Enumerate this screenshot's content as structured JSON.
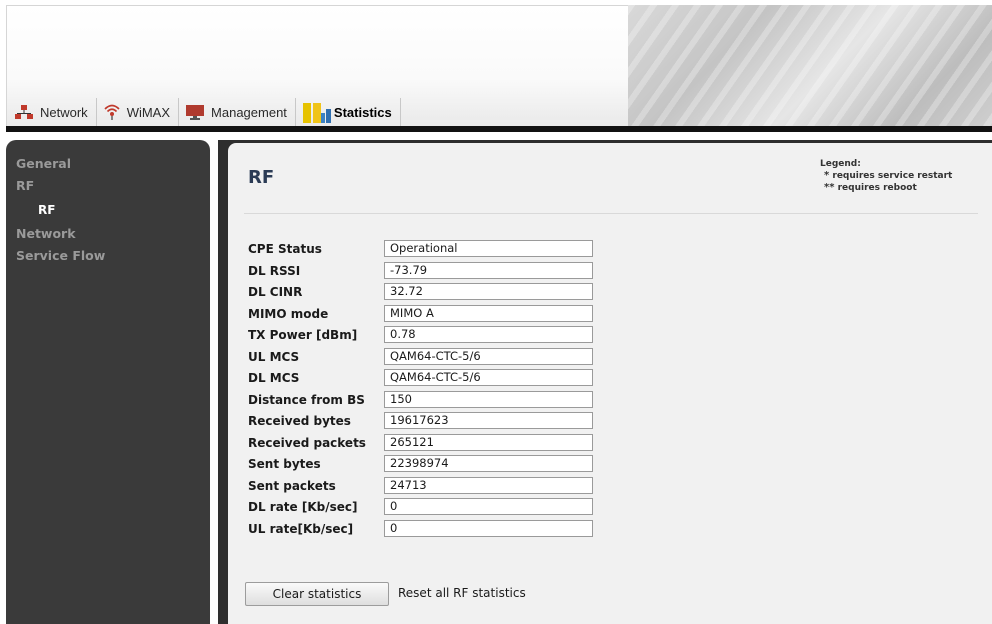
{
  "nav": {
    "items": [
      {
        "label": "Network",
        "icon": "network-icon"
      },
      {
        "label": "WiMAX",
        "icon": "wimax-icon"
      },
      {
        "label": "Management",
        "icon": "management-icon"
      },
      {
        "label": "Statistics",
        "icon": "statistics-icon",
        "active": true
      }
    ]
  },
  "sidebar": {
    "items": [
      {
        "label": "General"
      },
      {
        "label": "RF"
      },
      {
        "label": "RF",
        "sub": true,
        "active": true
      },
      {
        "label": "Network"
      },
      {
        "label": "Service Flow"
      }
    ]
  },
  "page": {
    "title": "RF"
  },
  "legend": {
    "title": "Legend:",
    "restart_mark": "*",
    "restart": "requires service restart",
    "reboot_mark": "**",
    "reboot": "requires reboot"
  },
  "stats": [
    {
      "label": "CPE Status",
      "value": "Operational"
    },
    {
      "label": "DL RSSI",
      "value": "-73.79"
    },
    {
      "label": "DL CINR",
      "value": "32.72"
    },
    {
      "label": "MIMO mode",
      "value": "MIMO A"
    },
    {
      "label": "TX Power [dBm]",
      "value": "0.78"
    },
    {
      "label": "UL MCS",
      "value": "QAM64-CTC-5/6"
    },
    {
      "label": "DL MCS",
      "value": "QAM64-CTC-5/6"
    },
    {
      "label": "Distance from BS",
      "value": "150"
    },
    {
      "label": "Received bytes",
      "value": "19617623"
    },
    {
      "label": "Received packets",
      "value": "265121"
    },
    {
      "label": "Sent bytes",
      "value": "22398974"
    },
    {
      "label": "Sent packets",
      "value": "24713"
    },
    {
      "label": "DL rate [Kb/sec]",
      "value": "0"
    },
    {
      "label": "UL rate[Kb/sec]",
      "value": "0"
    }
  ],
  "actions": {
    "clear_label": "Clear statistics",
    "clear_desc": "Reset all RF statistics"
  },
  "colors": {
    "sidebar_bg": "#3a3a3a",
    "panel_bg": "#f1f1f1",
    "title": "#2b3b55"
  }
}
